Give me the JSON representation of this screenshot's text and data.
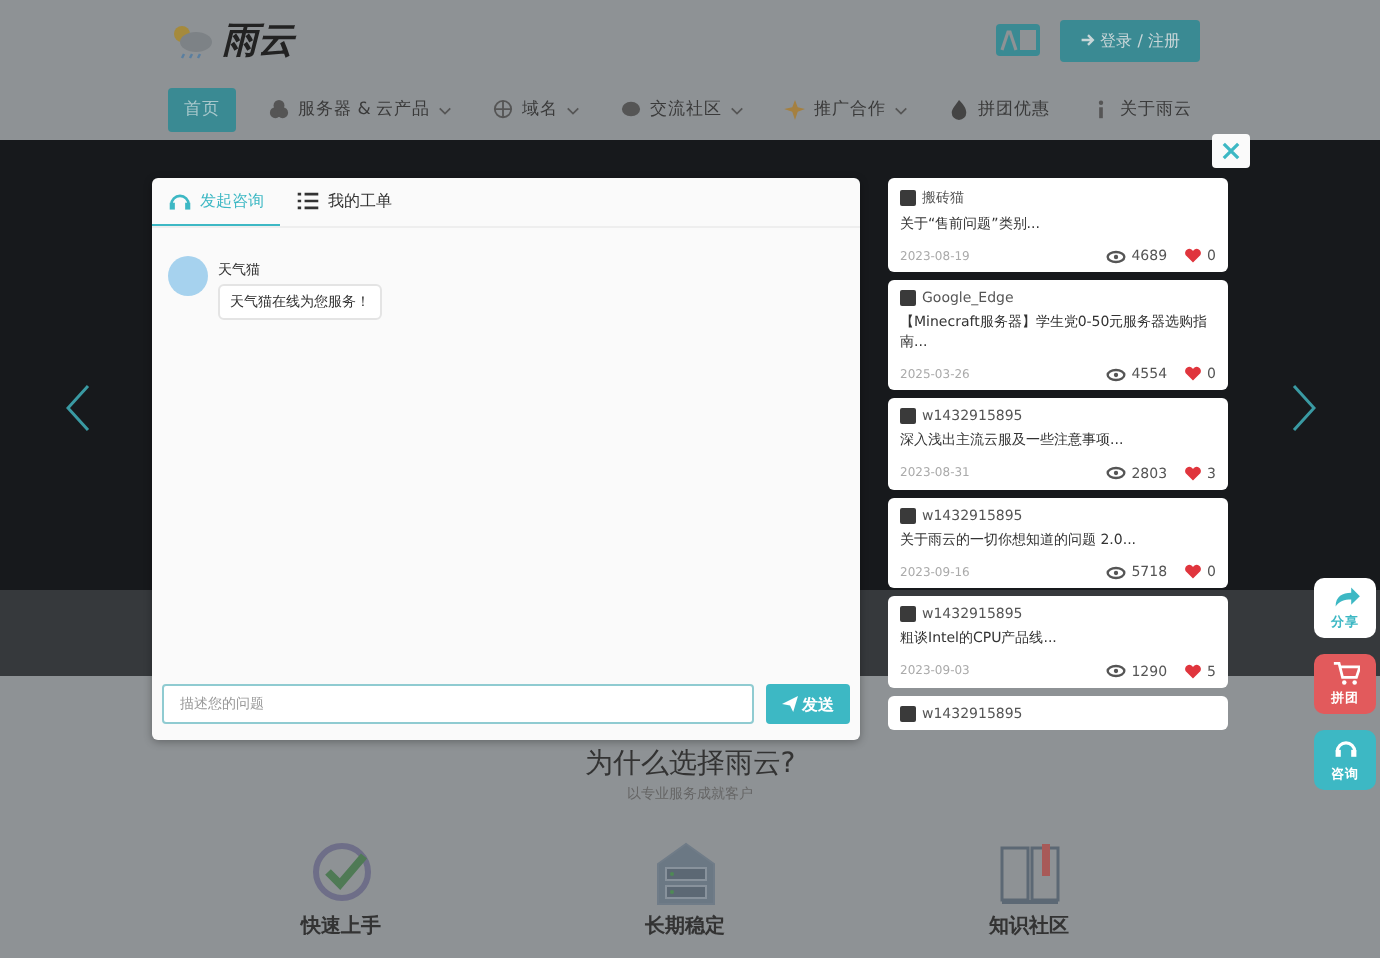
{
  "header": {
    "logo_text": "雨云",
    "login_button": "登录 / 注册"
  },
  "nav": [
    {
      "label": "首页",
      "selected": true,
      "dropdown": false
    },
    {
      "label": "服务器 & 云产品",
      "selected": false,
      "dropdown": true
    },
    {
      "label": "域名",
      "selected": false,
      "dropdown": true
    },
    {
      "label": "交流社区",
      "selected": false,
      "dropdown": true
    },
    {
      "label": "推广合作",
      "selected": false,
      "dropdown": true
    },
    {
      "label": "拼团优惠",
      "selected": false,
      "dropdown": false
    },
    {
      "label": "关于雨云",
      "selected": false,
      "dropdown": false
    }
  ],
  "chat": {
    "tabs": [
      {
        "label": "发起咨询",
        "selected": true
      },
      {
        "label": "我的工单",
        "selected": false
      }
    ],
    "message": {
      "sender": "天气猫",
      "text": "天气猫在线为您服务！"
    },
    "input": {
      "placeholder": "描述您的问题"
    },
    "send_button": "发送"
  },
  "posts": [
    {
      "author": "搬砖猫",
      "title": "关于“售前问题”类别...",
      "date": "2023-08-19",
      "views": "4689",
      "likes": "0"
    },
    {
      "author": "Google_Edge",
      "title": "【Minecraft服务器】学生党0-50元服务器选购指南...",
      "date": "2025-03-26",
      "views": "4554",
      "likes": "0"
    },
    {
      "author": "w1432915895",
      "title": "深入浅出主流云服及一些注意事项...",
      "date": "2023-08-31",
      "views": "2803",
      "likes": "3"
    },
    {
      "author": "w1432915895",
      "title": "关于雨云的一切你想知道的问题 2.0...",
      "date": "2023-09-16",
      "views": "5718",
      "likes": "0"
    },
    {
      "author": "w1432915895",
      "title": "粗谈Intel的CPU产品线...",
      "date": "2023-09-03",
      "views": "1290",
      "likes": "5"
    },
    {
      "author": "w1432915895"
    }
  ],
  "float_buttons": [
    {
      "label": "分享",
      "kind": "share"
    },
    {
      "label": "拼团",
      "kind": "cart"
    },
    {
      "label": "咨询",
      "kind": "support"
    }
  ],
  "why": {
    "title": "为什么选择雨云?",
    "subtitle": "以专业服务成就客户",
    "features": [
      {
        "label": "快速上手",
        "kind": "check"
      },
      {
        "label": "长期稳定",
        "kind": "server"
      },
      {
        "label": "知识社区",
        "kind": "book"
      }
    ]
  }
}
